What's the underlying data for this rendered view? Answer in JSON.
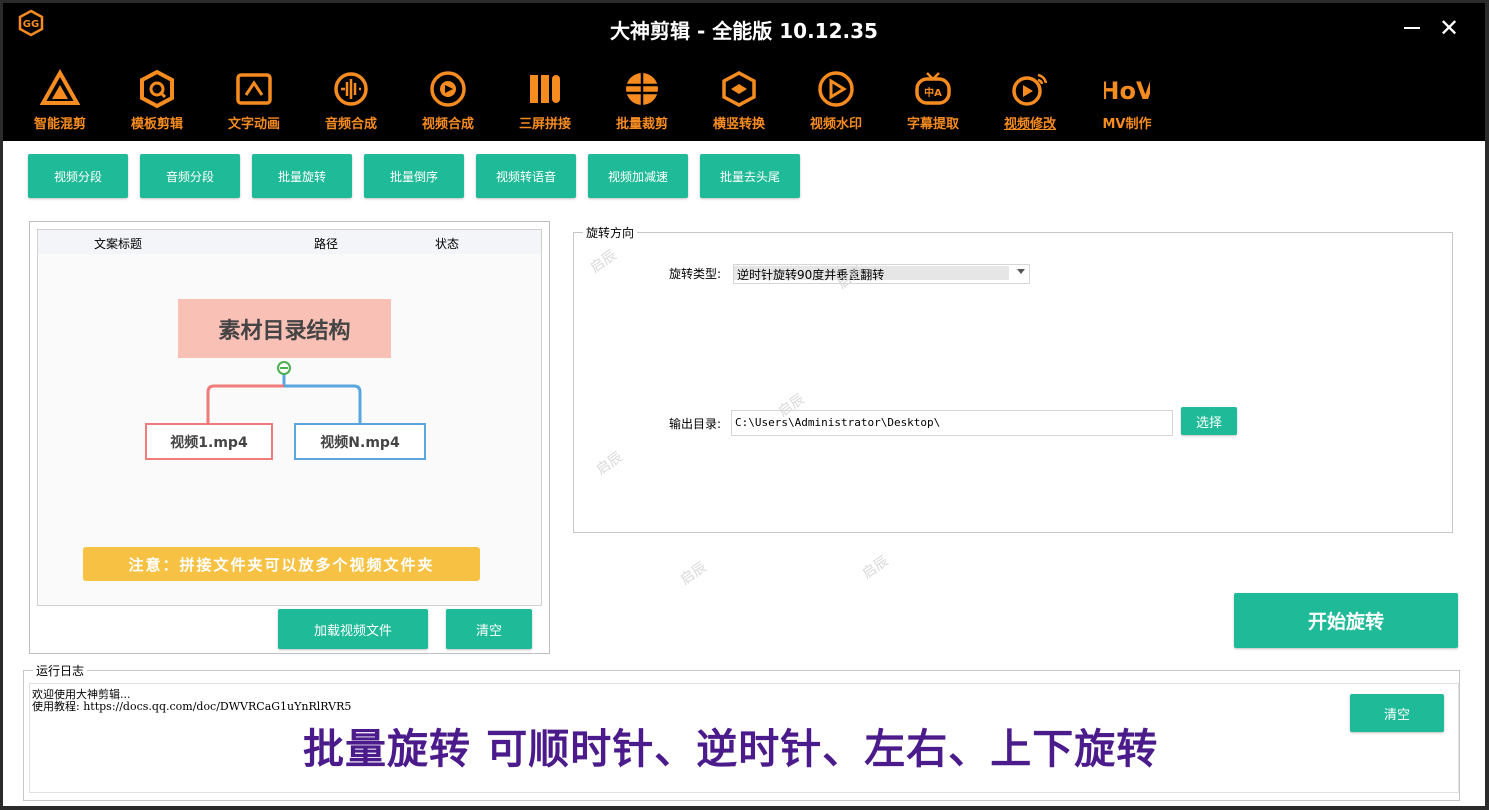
{
  "app": {
    "title": "大神剪辑 - 全能版 10.12.35",
    "minimize_symbol": "—",
    "close_symbol": "✕"
  },
  "nav": [
    {
      "label": "智能混剪",
      "icon": "triangle-logo-icon"
    },
    {
      "label": "模板剪辑",
      "icon": "hexagon-q-icon"
    },
    {
      "label": "文字动画",
      "icon": "text-frame-icon"
    },
    {
      "label": "音频合成",
      "icon": "audio-wave-icon"
    },
    {
      "label": "视频合成",
      "icon": "video-circle-icon"
    },
    {
      "label": "三屏拼接",
      "icon": "three-bars-icon"
    },
    {
      "label": "批量裁剪",
      "icon": "crop-circle-icon"
    },
    {
      "label": "横竖转换",
      "icon": "rotate-box-icon"
    },
    {
      "label": "视频水印",
      "icon": "watermark-play-icon"
    },
    {
      "label": "字幕提取",
      "icon": "subtitle-tv-icon"
    },
    {
      "label": "视频修改",
      "icon": "play-edit-icon",
      "active": true
    },
    {
      "label": "MV制作",
      "icon": "mv-logo-icon"
    }
  ],
  "subtabs": [
    "视频分段",
    "音频分段",
    "批量旋转",
    "批量倒序",
    "视频转语音",
    "视频加减速",
    "批量去头尾"
  ],
  "file_list": {
    "columns": [
      "文案标题",
      "路径",
      "状态"
    ],
    "diagram": {
      "root": "素材目录结构",
      "child1": "视频1.mp4",
      "child2": "视频N.mp4",
      "note": "注意：拼接文件夹可以放多个视频文件夹"
    },
    "load_button": "加载视频文件",
    "clear_button": "清空"
  },
  "rotate": {
    "legend": "旋转方向",
    "type_label": "旋转类型:",
    "type_value": "逆时针旋转90度并垂直翻转",
    "output_label": "输出目录:",
    "output_value": "C:\\Users\\Administrator\\Desktop\\",
    "select_button": "选择",
    "start_button": "开始旋转"
  },
  "log": {
    "legend": "运行日志",
    "line1": "欢迎使用大神剪辑...",
    "line2": "使用教程: https://docs.qq.com/doc/DWVRCaG1uYnRlRVR5",
    "clear_button": "清空"
  },
  "caption": "批量旋转 可顺时针、逆时针、左右、上下旋转",
  "watermark_text": "启辰",
  "colors": {
    "accent_orange": "#f68b1f",
    "button_teal": "#1fba97",
    "caption_purple": "#4b1b8c",
    "note_yellow": "#f7c244",
    "root_pink": "#f9c0b6"
  }
}
